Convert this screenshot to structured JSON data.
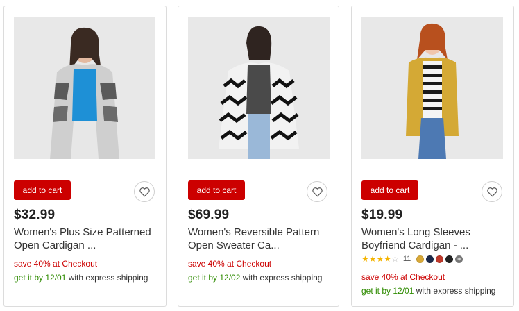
{
  "colors": {
    "cart_button": "#cc0000",
    "promo": "#cc0000",
    "ship_date": "#2e8b00",
    "star": "#f4b400"
  },
  "products": [
    {
      "price": "$32.99",
      "title_line1": "Women's Plus Size Patterned",
      "title_line2": "Open Cardigan ...",
      "cart_label": "add to cart",
      "promo": "save 40% at Checkout",
      "ship_prefix": "get it by 12/01",
      "ship_suffix": " with express shipping",
      "favorite_icon": "heart-outline-icon"
    },
    {
      "price": "$69.99",
      "title_line1": "Women's Reversible Pattern",
      "title_line2": "Open Sweater Ca...",
      "cart_label": "add to cart",
      "promo": "save 40% at Checkout",
      "ship_prefix": "get it by 12/02",
      "ship_suffix": " with express shipping",
      "favorite_icon": "heart-outline-icon"
    },
    {
      "price": "$19.99",
      "title_line1": "Women's Long Sleeves",
      "title_line2": "Boyfriend Cardigan - ...",
      "cart_label": "add to cart",
      "rating": 4,
      "rating_max": 5,
      "review_count": "11",
      "swatches": [
        "#d9a937",
        "#1d2a4a",
        "#c0392b",
        "#222222"
      ],
      "more_label": "+",
      "promo": "save 40% at Checkout",
      "ship_prefix": "get it by 12/01",
      "ship_suffix": " with express shipping",
      "favorite_icon": "heart-outline-icon"
    }
  ]
}
